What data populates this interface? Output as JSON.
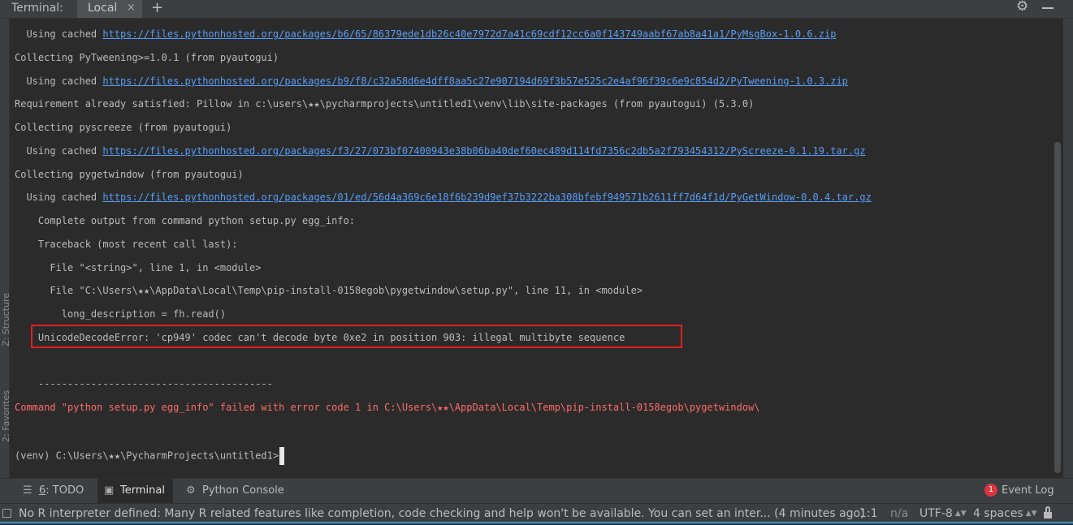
{
  "tabbar": {
    "title": "Terminal:",
    "tab_local": "Local",
    "close_glyph": "×",
    "add_glyph": "+",
    "gear_glyph": "⚙"
  },
  "left_gutter": {
    "structure_label": "Z: Structure",
    "favorites_label": "2: Favorites"
  },
  "terminal": {
    "lines": [
      {
        "prefix": "  Using cached ",
        "link": "https://files.pythonhosted.org/packages/b6/65/86379ede1db26c40e7972d7a41c69cdf12cc6a0f143749aabf67ab8a41a1/PyMsgBox-1.0.6.zip"
      },
      {
        "text": "Collecting PyTweening>=1.0.1 (from pyautogui)"
      },
      {
        "prefix": "  Using cached ",
        "link": "https://files.pythonhosted.org/packages/b9/f8/c32a58d6e4dff8aa5c27e907194d69f3b57e525c2e4af96f39c6e9c854d2/PyTweening-1.0.3.zip"
      },
      {
        "text": "Requirement already satisfied: Pillow in c:\\users\\★★\\pycharmprojects\\untitled1\\venv\\lib\\site-packages (from pyautogui) (5.3.0)"
      },
      {
        "text": "Collecting pyscreeze (from pyautogui)"
      },
      {
        "prefix": "  Using cached ",
        "link": "https://files.pythonhosted.org/packages/f3/27/073bf07400943e38b06ba40def60ec489d114fd7356c2db5a2f793454312/PyScreeze-0.1.19.tar.gz"
      },
      {
        "text": "Collecting pygetwindow (from pyautogui)"
      },
      {
        "prefix": "  Using cached ",
        "link": "https://files.pythonhosted.org/packages/01/ed/56d4a369c6e18f6b239d9ef37b3222ba308bfebf949571b2611ff7d64f1d/PyGetWindow-0.0.4.tar.gz"
      },
      {
        "text": "    Complete output from command python setup.py egg_info:"
      },
      {
        "text": "    Traceback (most recent call last):"
      },
      {
        "text": "      File \"<string>\", line 1, in <module>"
      },
      {
        "text": "      File \"C:\\Users\\★★\\AppData\\Local\\Temp\\pip-install-0158egob\\pygetwindow\\setup.py\", line 11, in <module>"
      },
      {
        "text": "        long_description = fh.read()"
      },
      {
        "text": "    UnicodeDecodeError: 'cp949' codec can't decode byte 0xe2 in position 903: illegal multibyte sequence"
      },
      {
        "text": ""
      },
      {
        "text": "    ----------------------------------------"
      },
      {
        "text": "Command \"python setup.py egg_info\" failed with error code 1 in C:\\Users\\★★\\AppData\\Local\\Temp\\pip-install-0158egob\\pygetwindow\\",
        "error": true
      },
      {
        "text": ""
      },
      {
        "text": "(venv) C:\\Users\\★★\\PycharmProjects\\untitled1>",
        "prompt": true
      }
    ]
  },
  "toolbar": {
    "todo_number": "6",
    "todo_label": ": TODO",
    "terminal_label": "Terminal",
    "python_console_label": "Python Console",
    "event_log_count": "1",
    "event_log_label": "Event Log"
  },
  "statusbar": {
    "message": "No R interpreter defined: Many R related features like completion, code checking and help won't be available. You can set an inter... (4 minutes ago)",
    "position": "1:1",
    "na": "n/a",
    "encoding": "UTF-8",
    "indent": "4 spaces"
  },
  "colors": {
    "background": "#2b2b2b",
    "link": "#589df6",
    "error": "#ff6b68",
    "highlight_box": "#e01e1e"
  }
}
